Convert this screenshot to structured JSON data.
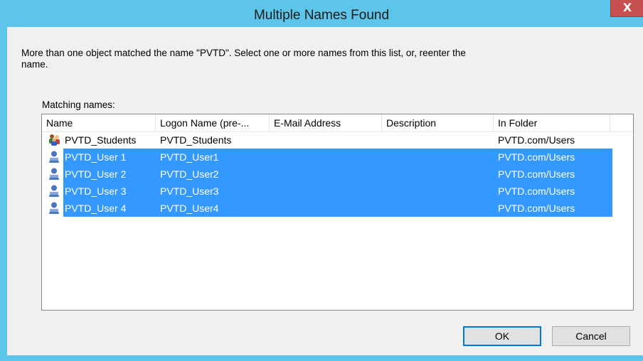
{
  "window": {
    "title": "Multiple Names Found",
    "close_label": "X"
  },
  "message": "More than one object matched the name \"PVTD\". Select one or more names from this list, or, reenter the name.",
  "matching_label": "Matching names:",
  "columns": [
    "Name",
    "Logon Name (pre-...",
    "E-Mail Address",
    "Description",
    "In Folder"
  ],
  "rows": [
    {
      "name": "PVTD_Students",
      "logon": "PVTD_Students",
      "email": "",
      "description": "",
      "folder": "PVTD.com/Users",
      "icon": "group-icon",
      "selected": false
    },
    {
      "name": "PVTD_User 1",
      "logon": "PVTD_User1",
      "email": "",
      "description": "",
      "folder": "PVTD.com/Users",
      "icon": "user-icon",
      "selected": true
    },
    {
      "name": "PVTD_User 2",
      "logon": "PVTD_User2",
      "email": "",
      "description": "",
      "folder": "PVTD.com/Users",
      "icon": "user-icon",
      "selected": true
    },
    {
      "name": "PVTD_User 3",
      "logon": "PVTD_User3",
      "email": "",
      "description": "",
      "folder": "PVTD.com/Users",
      "icon": "user-icon",
      "selected": true
    },
    {
      "name": "PVTD_User 4",
      "logon": "PVTD_User4",
      "email": "",
      "description": "",
      "folder": "PVTD.com/Users",
      "icon": "user-icon",
      "selected": true
    }
  ],
  "buttons": {
    "ok": "OK",
    "cancel": "Cancel"
  },
  "colors": {
    "titlebar": "#5ec5ea",
    "selection": "#3399ff",
    "close": "#c75050"
  }
}
